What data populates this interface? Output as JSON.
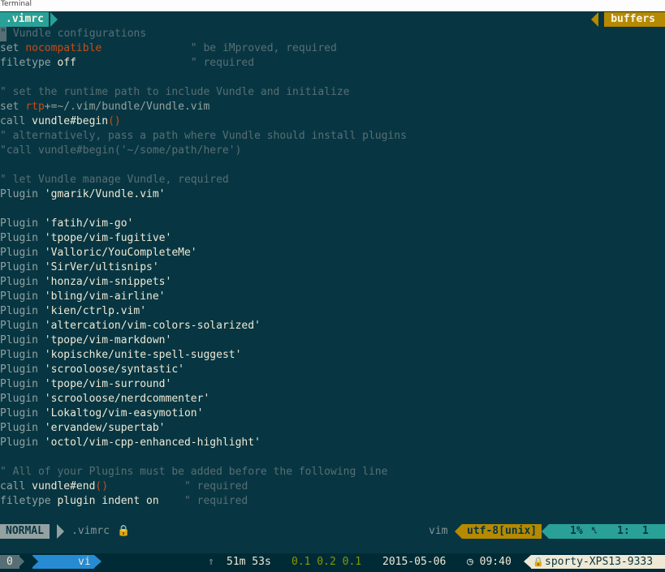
{
  "window": {
    "title": "Terminal"
  },
  "tabline": {
    "current_tab": ".vimrc",
    "buffers_label": "buffers"
  },
  "editor": {
    "lines": [
      [
        {
          "t": "\"",
          "c": "cursor"
        },
        {
          "t": " Vundle configurations",
          "c": "c"
        }
      ],
      [
        {
          "t": "set ",
          "c": "k"
        },
        {
          "t": "nocompatible",
          "c": "o"
        },
        {
          "t": "              \" be iMproved, required",
          "c": "c"
        }
      ],
      [
        {
          "t": "filetype ",
          "c": "k"
        },
        {
          "t": "off",
          "c": "w"
        },
        {
          "t": "                  \" required",
          "c": "c"
        }
      ],
      [],
      [
        {
          "t": "\" set the runtime path to include Vundle and initialize",
          "c": "c"
        }
      ],
      [
        {
          "t": "set ",
          "c": "k"
        },
        {
          "t": "rtp",
          "c": "o"
        },
        {
          "t": "+=~/.vim/bundle/Vundle.vim",
          "c": "k"
        }
      ],
      [
        {
          "t": "call ",
          "c": "k"
        },
        {
          "t": "vundle#begin",
          "c": "w"
        },
        {
          "t": "()",
          "c": "o"
        }
      ],
      [
        {
          "t": "\" alternatively, pass a path where Vundle should install plugins",
          "c": "c"
        }
      ],
      [
        {
          "t": "\"call vundle#begin('~/some/path/here')",
          "c": "c"
        }
      ],
      [],
      [
        {
          "t": "\" let Vundle manage Vundle, required",
          "c": "c"
        }
      ],
      [
        {
          "t": "Plugin ",
          "c": "k"
        },
        {
          "t": "'gmarik/Vundle.vim'",
          "c": "w"
        }
      ],
      [],
      [
        {
          "t": "Plugin ",
          "c": "k"
        },
        {
          "t": "'fatih/vim-go'",
          "c": "w"
        }
      ],
      [
        {
          "t": "Plugin ",
          "c": "k"
        },
        {
          "t": "'tpope/vim-fugitive'",
          "c": "w"
        }
      ],
      [
        {
          "t": "Plugin ",
          "c": "k"
        },
        {
          "t": "'Valloric/YouCompleteMe'",
          "c": "w"
        }
      ],
      [
        {
          "t": "Plugin ",
          "c": "k"
        },
        {
          "t": "'SirVer/ultisnips'",
          "c": "w"
        }
      ],
      [
        {
          "t": "Plugin ",
          "c": "k"
        },
        {
          "t": "'honza/vim-snippets'",
          "c": "w"
        }
      ],
      [
        {
          "t": "Plugin ",
          "c": "k"
        },
        {
          "t": "'bling/vim-airline'",
          "c": "w"
        }
      ],
      [
        {
          "t": "Plugin ",
          "c": "k"
        },
        {
          "t": "'kien/ctrlp.vim'",
          "c": "w"
        }
      ],
      [
        {
          "t": "Plugin ",
          "c": "k"
        },
        {
          "t": "'altercation/vim-colors-solarized'",
          "c": "w"
        }
      ],
      [
        {
          "t": "Plugin ",
          "c": "k"
        },
        {
          "t": "'tpope/vim-markdown'",
          "c": "w"
        }
      ],
      [
        {
          "t": "Plugin ",
          "c": "k"
        },
        {
          "t": "'kopischke/unite-spell-suggest'",
          "c": "w"
        }
      ],
      [
        {
          "t": "Plugin ",
          "c": "k"
        },
        {
          "t": "'scrooloose/syntastic'",
          "c": "w"
        }
      ],
      [
        {
          "t": "Plugin ",
          "c": "k"
        },
        {
          "t": "'tpope/vim-surround'",
          "c": "w"
        }
      ],
      [
        {
          "t": "Plugin ",
          "c": "k"
        },
        {
          "t": "'scrooloose/nerdcommenter'",
          "c": "w"
        }
      ],
      [
        {
          "t": "Plugin ",
          "c": "k"
        },
        {
          "t": "'Lokaltog/vim-easymotion'",
          "c": "w"
        }
      ],
      [
        {
          "t": "Plugin ",
          "c": "k"
        },
        {
          "t": "'ervandew/supertab'",
          "c": "w"
        }
      ],
      [
        {
          "t": "Plugin ",
          "c": "k"
        },
        {
          "t": "'octol/vim-cpp-enhanced-highlight'",
          "c": "w"
        }
      ],
      [],
      [
        {
          "t": "\" All of your Plugins must be added before the following line",
          "c": "c"
        }
      ],
      [
        {
          "t": "call ",
          "c": "k"
        },
        {
          "t": "vundle#end",
          "c": "w"
        },
        {
          "t": "()",
          "c": "o"
        },
        {
          "t": "            \" required",
          "c": "c"
        }
      ],
      [
        {
          "t": "filetype ",
          "c": "k"
        },
        {
          "t": "plugin indent on",
          "c": "w"
        },
        {
          "t": "    \" required",
          "c": "c"
        }
      ]
    ]
  },
  "statusline": {
    "mode": "NORMAL",
    "filename": ".vimrc",
    "lock_icon": "🔒",
    "filetype": "vim",
    "encoding": "utf-8[unix]",
    "percent": "1%",
    "line_icon": "␤",
    "line": "1:",
    "col": "1"
  },
  "tmux": {
    "window_index": "0",
    "current_window": "vi",
    "uptime_icon": "⇑",
    "uptime": "51m 53s",
    "load": "0.1 0.2 0.1",
    "date": "2015-05-06",
    "clock_icon": "◷",
    "time": "09:40",
    "host_icon": "🔒",
    "hostname": "sporty-XPS13-9333"
  },
  "colors": {
    "background": "#073642",
    "accent_cyan": "#2aa198",
    "accent_yellow": "#b58900",
    "accent_blue": "#268bd2",
    "accent_orange": "#cb4b16"
  }
}
